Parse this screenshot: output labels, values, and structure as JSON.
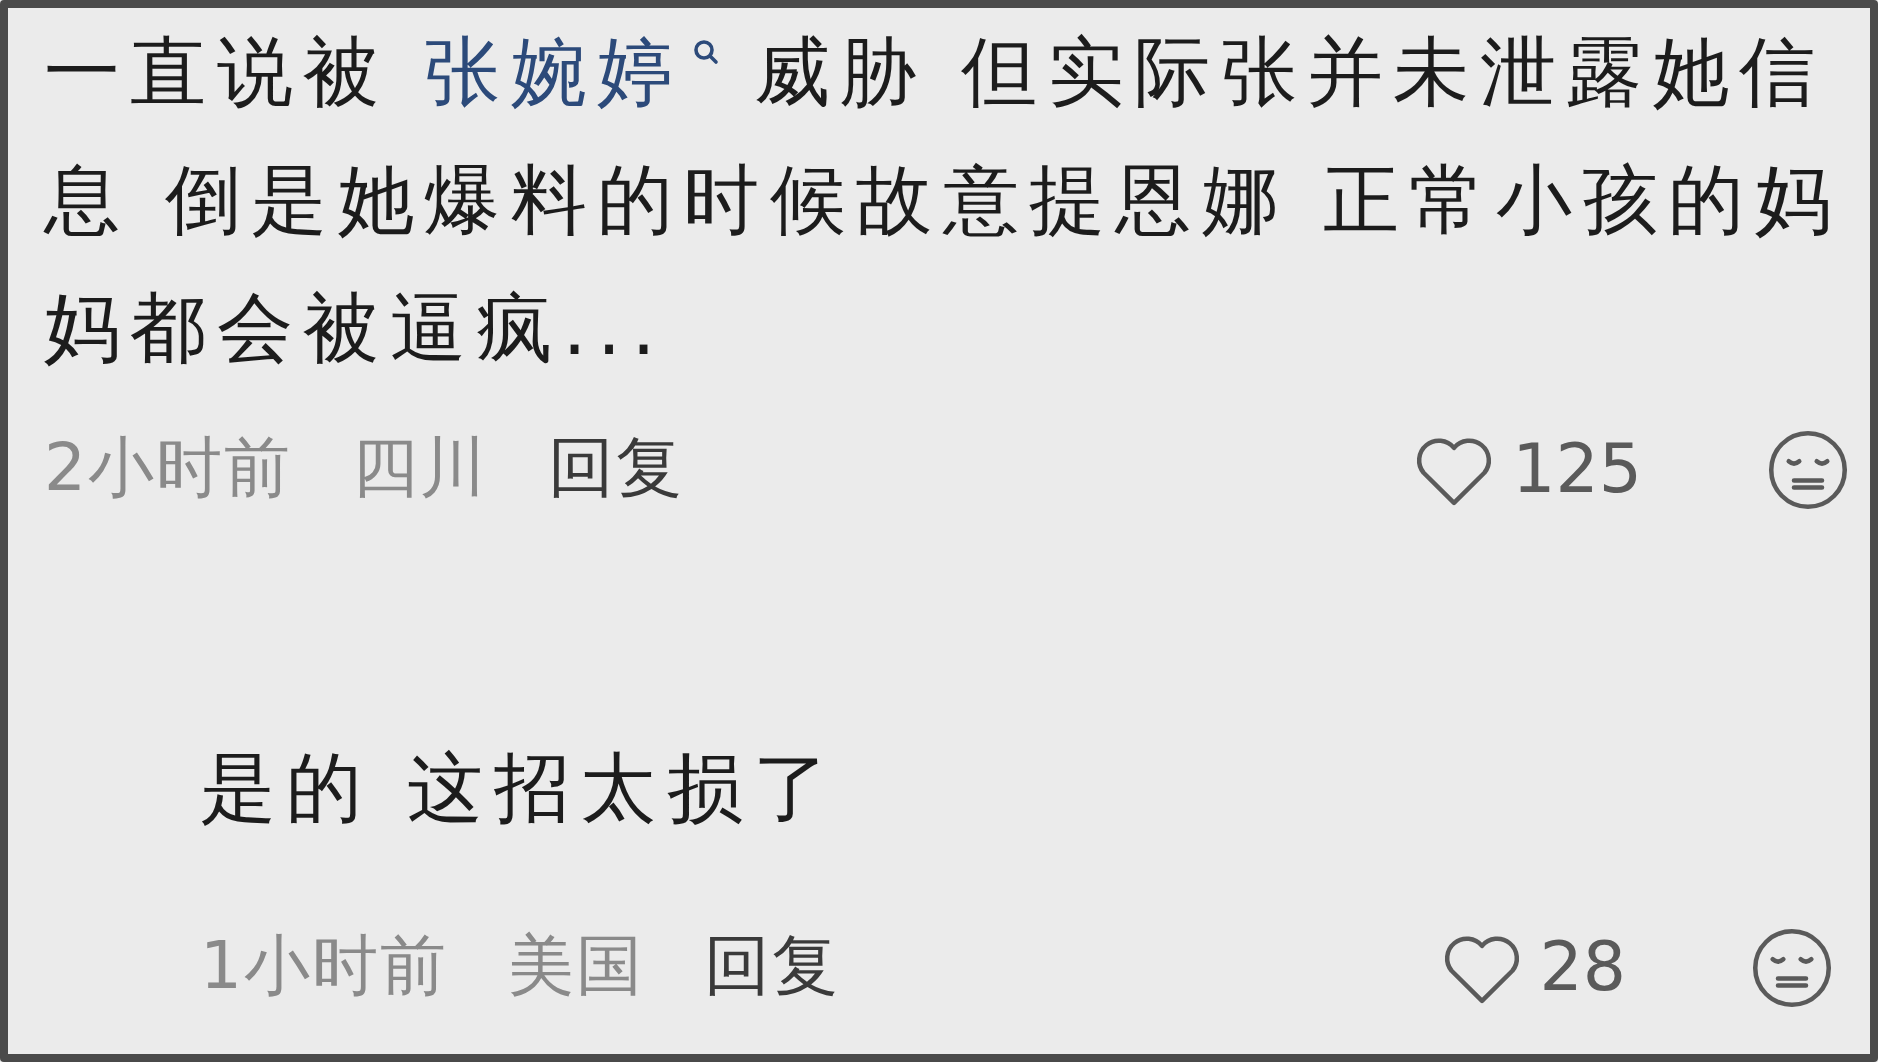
{
  "comments": [
    {
      "kind": "comment",
      "text_before": "一直说被 ",
      "link": "张婉婷",
      "text_after": " 威胁 但实际张并未泄露她信息 倒是她爆料的时候故意提恩娜 正常小孩的妈妈都会被逼疯...",
      "time": "2小时前",
      "location": "四川",
      "reply": "回复",
      "likes": "125"
    },
    {
      "kind": "reply",
      "text_before": "是的 这招太损了",
      "time": "1小时前",
      "location": "美国",
      "reply": "回复",
      "likes": "28"
    }
  ]
}
